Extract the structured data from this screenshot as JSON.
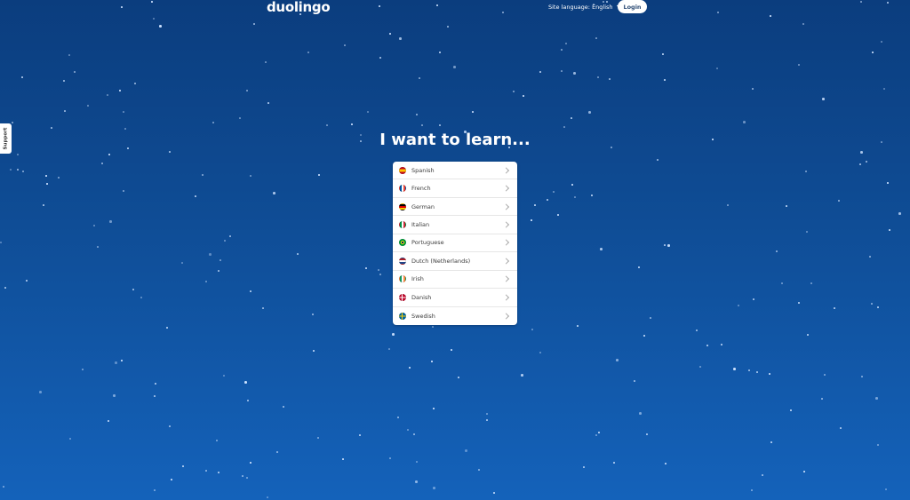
{
  "header": {
    "logo_text": "duolingo",
    "site_language_label": "Site language: English",
    "login_label": "Login"
  },
  "support_tab_label": "Support",
  "heading": "I want to learn...",
  "languages": [
    {
      "label": "Spanish",
      "flag_icon": "spain-flag-icon",
      "flag_colors": [
        "#c60b1e",
        "#ffc400",
        "#c60b1e"
      ]
    },
    {
      "label": "French",
      "flag_icon": "france-flag-icon",
      "flag_colors": [
        "#0055a4",
        "#ffffff",
        "#ef4135"
      ]
    },
    {
      "label": "German",
      "flag_icon": "germany-flag-icon",
      "flag_colors": [
        "#000000",
        "#dd0000",
        "#ffce00"
      ]
    },
    {
      "label": "Italian",
      "flag_icon": "italy-flag-icon",
      "flag_colors": [
        "#009246",
        "#ffffff",
        "#ce2b37"
      ]
    },
    {
      "label": "Portuguese",
      "flag_icon": "brazil-flag-icon",
      "flag_colors": [
        "#009c3b",
        "#ffdf00",
        "#002776"
      ]
    },
    {
      "label": "Dutch (Netherlands)",
      "flag_icon": "netherlands-flag-icon",
      "flag_colors": [
        "#ae1c28",
        "#ffffff",
        "#21468b"
      ]
    },
    {
      "label": "Irish",
      "flag_icon": "ireland-flag-icon",
      "flag_colors": [
        "#169b62",
        "#ffffff",
        "#ff883e"
      ]
    },
    {
      "label": "Danish",
      "flag_icon": "denmark-flag-icon",
      "flag_colors": [
        "#c60c30",
        "#ffffff",
        "#c60c30"
      ]
    },
    {
      "label": "Swedish",
      "flag_icon": "sweden-flag-icon",
      "flag_colors": [
        "#006aa7",
        "#fecc00",
        "#006aa7"
      ]
    }
  ],
  "colors": {
    "background_top": "#0b3d7e",
    "background_bottom": "#1462ba",
    "card": "#ffffff"
  }
}
